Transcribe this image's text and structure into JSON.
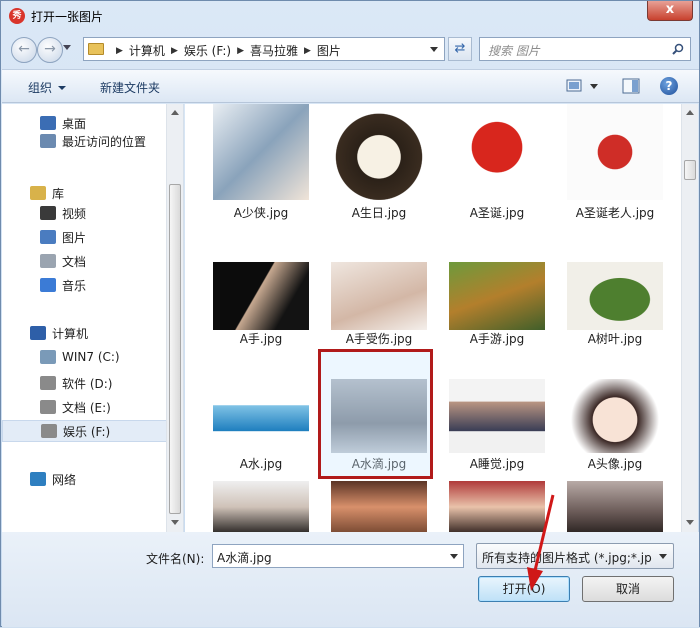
{
  "window": {
    "title": "打开一张图片",
    "app_icon": "秀",
    "close_glyph": "x"
  },
  "address": {
    "crumbs": [
      "计算机",
      "娱乐 (F:)",
      "喜马拉雅",
      "图片"
    ]
  },
  "search": {
    "placeholder": "搜索 图片"
  },
  "toolbar": {
    "organize": "组织",
    "new_folder": "新建文件夹",
    "help_glyph": "?"
  },
  "sidebar": {
    "items": [
      {
        "label": "桌面",
        "icon": "desktop-icon"
      },
      {
        "label": "最近访问的位置",
        "icon": "recent-places-icon"
      },
      {
        "label": "库",
        "icon": "library-icon"
      },
      {
        "label": "视频",
        "icon": "video-icon"
      },
      {
        "label": "图片",
        "icon": "pictures-icon"
      },
      {
        "label": "文档",
        "icon": "documents-icon"
      },
      {
        "label": "音乐",
        "icon": "music-icon"
      },
      {
        "label": "计算机",
        "icon": "computer-icon"
      },
      {
        "label": "WIN7 (C:)",
        "icon": "drive-c-icon"
      },
      {
        "label": "软件 (D:)",
        "icon": "drive-icon"
      },
      {
        "label": "文档 (E:)",
        "icon": "drive-icon"
      },
      {
        "label": "娱乐 (F:)",
        "icon": "drive-icon"
      },
      {
        "label": "网络",
        "icon": "network-icon"
      }
    ],
    "selected": "娱乐 (F:)"
  },
  "files": [
    {
      "name": "A少侠.jpg"
    },
    {
      "name": "A生日.jpg"
    },
    {
      "name": "A圣诞.jpg"
    },
    {
      "name": "A圣诞老人.jpg"
    },
    {
      "name": "A手.jpg"
    },
    {
      "name": "A手受伤.jpg"
    },
    {
      "name": "A手游.jpg"
    },
    {
      "name": "A树叶.jpg"
    },
    {
      "name": "A水.jpg"
    },
    {
      "name": "A水滴.jpg"
    },
    {
      "name": "A睡觉.jpg"
    },
    {
      "name": "A头像.jpg"
    },
    {
      "name": ""
    },
    {
      "name": ""
    },
    {
      "name": ""
    },
    {
      "name": ""
    }
  ],
  "selected_file": "A水滴.jpg",
  "bottom": {
    "filename_label": "文件名(N):",
    "filename_value": "A水滴.jpg",
    "filter_value": "所有支持的图片格式 (*.jpg;*.jp",
    "open_label": "打开(O)",
    "cancel_label": "取消"
  },
  "colors": {
    "accent": "#3c7fb1",
    "highlight": "#b11a1a",
    "arrow": "#d01818"
  }
}
